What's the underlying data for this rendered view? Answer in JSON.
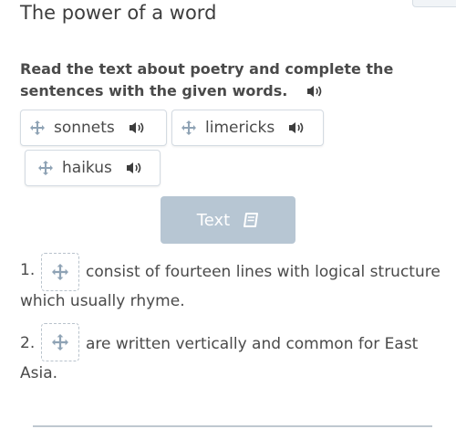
{
  "page": {
    "title": "The power of a word"
  },
  "task": {
    "instruction": "Read the text about poetry and complete the sentences with the given words."
  },
  "chips": [
    {
      "label": "sonnets"
    },
    {
      "label": "limericks"
    },
    {
      "label": "haikus"
    }
  ],
  "text_button": {
    "label": "Text",
    "icon": "book-icon"
  },
  "sentences": [
    {
      "number": "1.",
      "before": "",
      "after_line1": "consist of fourteen lines with logical structure",
      "after_line2": "which usually rhyme."
    },
    {
      "number": "2.",
      "before": "",
      "after_line1": "are written vertically and common for East",
      "after_line2": "Asia."
    }
  ],
  "colors": {
    "text": "#4a4a4a",
    "button": "#b7c6d3",
    "chip_border": "#d4dbe2",
    "icon": "#8fa3b5"
  }
}
